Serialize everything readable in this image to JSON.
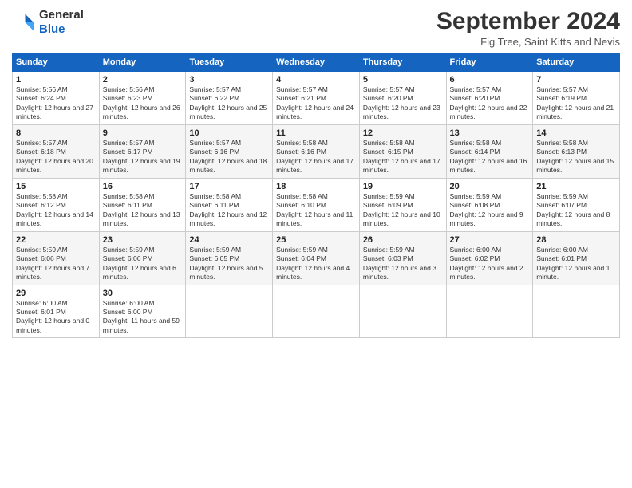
{
  "logo": {
    "line1": "General",
    "line2": "Blue"
  },
  "header": {
    "month": "September 2024",
    "location": "Fig Tree, Saint Kitts and Nevis"
  },
  "weekdays": [
    "Sunday",
    "Monday",
    "Tuesday",
    "Wednesday",
    "Thursday",
    "Friday",
    "Saturday"
  ],
  "weeks": [
    [
      {
        "day": "1",
        "sunrise": "5:56 AM",
        "sunset": "6:24 PM",
        "daylight": "12 hours and 27 minutes."
      },
      {
        "day": "2",
        "sunrise": "5:56 AM",
        "sunset": "6:23 PM",
        "daylight": "12 hours and 26 minutes."
      },
      {
        "day": "3",
        "sunrise": "5:57 AM",
        "sunset": "6:22 PM",
        "daylight": "12 hours and 25 minutes."
      },
      {
        "day": "4",
        "sunrise": "5:57 AM",
        "sunset": "6:21 PM",
        "daylight": "12 hours and 24 minutes."
      },
      {
        "day": "5",
        "sunrise": "5:57 AM",
        "sunset": "6:20 PM",
        "daylight": "12 hours and 23 minutes."
      },
      {
        "day": "6",
        "sunrise": "5:57 AM",
        "sunset": "6:20 PM",
        "daylight": "12 hours and 22 minutes."
      },
      {
        "day": "7",
        "sunrise": "5:57 AM",
        "sunset": "6:19 PM",
        "daylight": "12 hours and 21 minutes."
      }
    ],
    [
      {
        "day": "8",
        "sunrise": "5:57 AM",
        "sunset": "6:18 PM",
        "daylight": "12 hours and 20 minutes."
      },
      {
        "day": "9",
        "sunrise": "5:57 AM",
        "sunset": "6:17 PM",
        "daylight": "12 hours and 19 minutes."
      },
      {
        "day": "10",
        "sunrise": "5:57 AM",
        "sunset": "6:16 PM",
        "daylight": "12 hours and 18 minutes."
      },
      {
        "day": "11",
        "sunrise": "5:58 AM",
        "sunset": "6:16 PM",
        "daylight": "12 hours and 17 minutes."
      },
      {
        "day": "12",
        "sunrise": "5:58 AM",
        "sunset": "6:15 PM",
        "daylight": "12 hours and 17 minutes."
      },
      {
        "day": "13",
        "sunrise": "5:58 AM",
        "sunset": "6:14 PM",
        "daylight": "12 hours and 16 minutes."
      },
      {
        "day": "14",
        "sunrise": "5:58 AM",
        "sunset": "6:13 PM",
        "daylight": "12 hours and 15 minutes."
      }
    ],
    [
      {
        "day": "15",
        "sunrise": "5:58 AM",
        "sunset": "6:12 PM",
        "daylight": "12 hours and 14 minutes."
      },
      {
        "day": "16",
        "sunrise": "5:58 AM",
        "sunset": "6:11 PM",
        "daylight": "12 hours and 13 minutes."
      },
      {
        "day": "17",
        "sunrise": "5:58 AM",
        "sunset": "6:11 PM",
        "daylight": "12 hours and 12 minutes."
      },
      {
        "day": "18",
        "sunrise": "5:58 AM",
        "sunset": "6:10 PM",
        "daylight": "12 hours and 11 minutes."
      },
      {
        "day": "19",
        "sunrise": "5:59 AM",
        "sunset": "6:09 PM",
        "daylight": "12 hours and 10 minutes."
      },
      {
        "day": "20",
        "sunrise": "5:59 AM",
        "sunset": "6:08 PM",
        "daylight": "12 hours and 9 minutes."
      },
      {
        "day": "21",
        "sunrise": "5:59 AM",
        "sunset": "6:07 PM",
        "daylight": "12 hours and 8 minutes."
      }
    ],
    [
      {
        "day": "22",
        "sunrise": "5:59 AM",
        "sunset": "6:06 PM",
        "daylight": "12 hours and 7 minutes."
      },
      {
        "day": "23",
        "sunrise": "5:59 AM",
        "sunset": "6:06 PM",
        "daylight": "12 hours and 6 minutes."
      },
      {
        "day": "24",
        "sunrise": "5:59 AM",
        "sunset": "6:05 PM",
        "daylight": "12 hours and 5 minutes."
      },
      {
        "day": "25",
        "sunrise": "5:59 AM",
        "sunset": "6:04 PM",
        "daylight": "12 hours and 4 minutes."
      },
      {
        "day": "26",
        "sunrise": "5:59 AM",
        "sunset": "6:03 PM",
        "daylight": "12 hours and 3 minutes."
      },
      {
        "day": "27",
        "sunrise": "6:00 AM",
        "sunset": "6:02 PM",
        "daylight": "12 hours and 2 minutes."
      },
      {
        "day": "28",
        "sunrise": "6:00 AM",
        "sunset": "6:01 PM",
        "daylight": "12 hours and 1 minute."
      }
    ],
    [
      {
        "day": "29",
        "sunrise": "6:00 AM",
        "sunset": "6:01 PM",
        "daylight": "12 hours and 0 minutes."
      },
      {
        "day": "30",
        "sunrise": "6:00 AM",
        "sunset": "6:00 PM",
        "daylight": "11 hours and 59 minutes."
      },
      null,
      null,
      null,
      null,
      null
    ]
  ]
}
